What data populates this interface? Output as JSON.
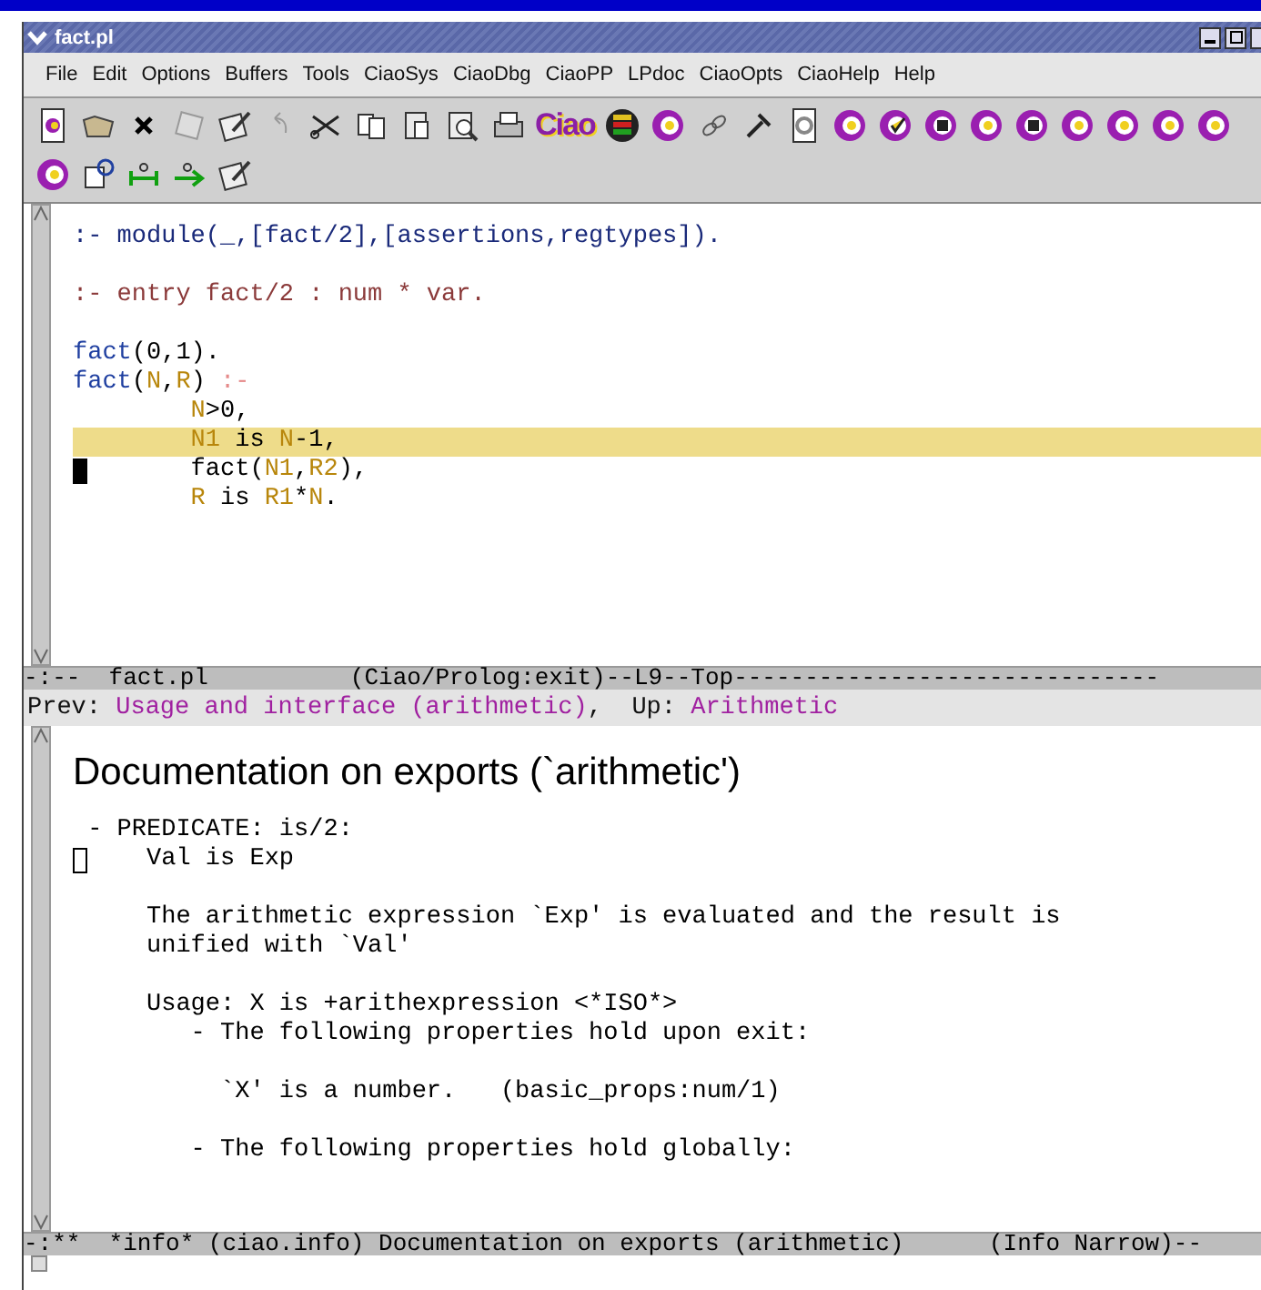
{
  "window": {
    "title": "fact.pl"
  },
  "menu": [
    "File",
    "Edit",
    "Options",
    "Buffers",
    "Tools",
    "CiaoSys",
    "CiaoDbg",
    "CiaoPP",
    "LPdoc",
    "CiaoOpts",
    "CiaoHelp",
    "Help"
  ],
  "toolbar": {
    "logo": "Ciao"
  },
  "editor": {
    "paragraphs": [
      [
        {
          "highlighted": false,
          "cursor": false,
          "segments": [
            {
              "text": ":- module(_,[fact/2],[assertions,regtypes]).",
              "kind": "directive"
            }
          ]
        }
      ],
      [
        {
          "highlighted": false,
          "cursor": false,
          "segments": [
            {
              "text": ":- entry fact/2 : num * var.",
              "kind": "assertion"
            }
          ]
        }
      ],
      [
        {
          "highlighted": false,
          "cursor": false,
          "segments": [
            {
              "text": "fact",
              "kind": "head"
            },
            {
              "text": "(0,1).",
              "kind": "plain"
            }
          ]
        },
        {
          "highlighted": false,
          "cursor": false,
          "segments": [
            {
              "text": "fact",
              "kind": "head"
            },
            {
              "text": "(",
              "kind": "plain"
            },
            {
              "text": "N",
              "kind": "variable"
            },
            {
              "text": ",",
              "kind": "plain"
            },
            {
              "text": "R",
              "kind": "variable"
            },
            {
              "text": ") ",
              "kind": "plain"
            },
            {
              "text": ":-",
              "kind": "neck"
            }
          ]
        },
        {
          "highlighted": false,
          "cursor": false,
          "segments": [
            {
              "text": "        N",
              "kind": "variable"
            },
            {
              "text": ">0,",
              "kind": "plain"
            }
          ]
        },
        {
          "highlighted": true,
          "cursor": false,
          "segments": [
            {
              "text": "        N1",
              "kind": "variable"
            },
            {
              "text": " is ",
              "kind": "plain"
            },
            {
              "text": "N",
              "kind": "variable"
            },
            {
              "text": "-1,",
              "kind": "plain"
            }
          ]
        },
        {
          "highlighted": false,
          "cursor": true,
          "segments": [
            {
              "text": "        fact(",
              "kind": "plain"
            },
            {
              "text": "N1",
              "kind": "variable"
            },
            {
              "text": ",",
              "kind": "plain"
            },
            {
              "text": "R2",
              "kind": "variable"
            },
            {
              "text": "),",
              "kind": "plain"
            }
          ]
        },
        {
          "highlighted": false,
          "cursor": false,
          "segments": [
            {
              "text": "        R",
              "kind": "variable"
            },
            {
              "text": " is ",
              "kind": "plain"
            },
            {
              "text": "R1",
              "kind": "variable"
            },
            {
              "text": "*",
              "kind": "plain"
            },
            {
              "text": "N",
              "kind": "variable"
            },
            {
              "text": ".",
              "kind": "plain"
            }
          ]
        }
      ]
    ],
    "modeline": "-:--  fact.pl          (Ciao/Prolog:exit)--L9--Top------------------------------"
  },
  "info": {
    "prev_label": "Prev:",
    "prev_link": "Usage and interface (arithmetic)",
    "separator": ",",
    "up_label": "Up:",
    "up_link": "Arithmetic",
    "heading": "Documentation on exports (`arithmetic')",
    "paragraphs": [
      [
        {
          "text": " - PREDICATE: is/2:",
          "cursor": false
        },
        {
          "text": "     Val is Exp",
          "cursor": true
        }
      ],
      [
        {
          "text": "     The arithmetic expression `Exp' is evaluated and the result is",
          "cursor": false
        },
        {
          "text": "     unified with `Val'",
          "cursor": false
        }
      ],
      [
        {
          "text": "     Usage: X is +arithexpression <*ISO*>",
          "cursor": false
        },
        {
          "text": "        - The following properties hold upon exit:",
          "cursor": false
        }
      ],
      [
        {
          "text": "          `X' is a number.   (basic_props:num/1)",
          "cursor": false
        }
      ],
      [
        {
          "text": "        - The following properties hold globally:",
          "cursor": false
        }
      ]
    ],
    "modeline": "-:**  *info* (ciao.info) Documentation on exports (arithmetic)      (Info Narrow)--"
  }
}
